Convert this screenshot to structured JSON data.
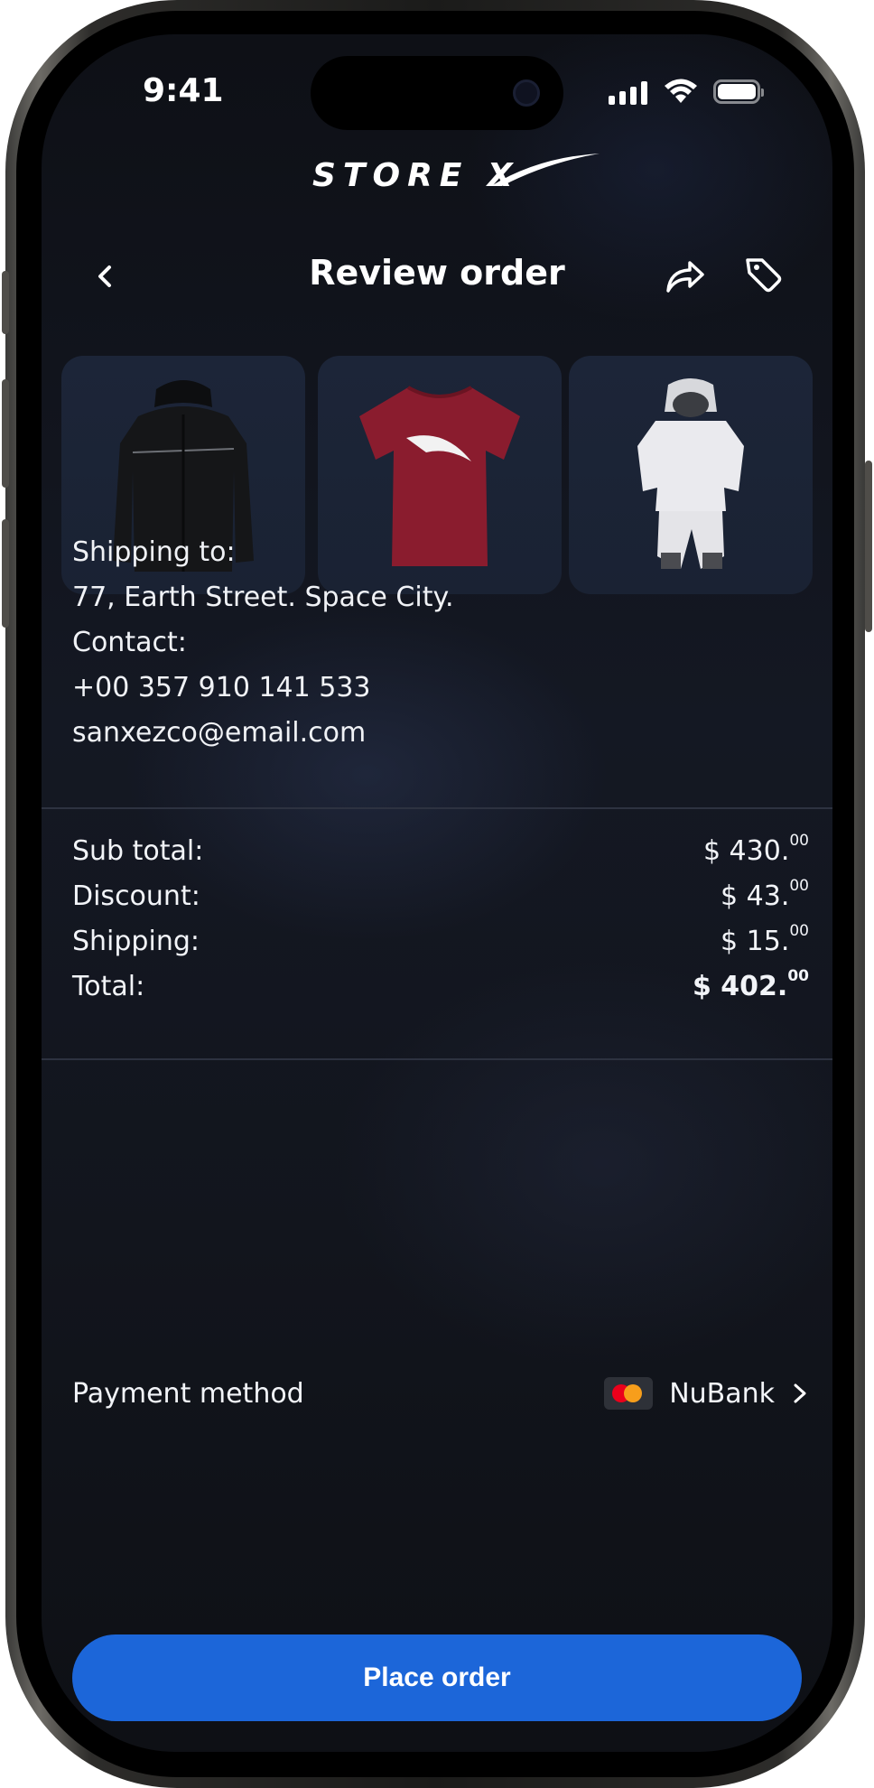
{
  "status_bar": {
    "time": "9:41"
  },
  "brand": {
    "logo_text": "STORE X"
  },
  "header": {
    "title": "Review order",
    "back_icon": "chevron-left-icon",
    "share_icon": "share-icon",
    "tag_icon": "tag-icon"
  },
  "products": [
    {
      "name": "black-jacket",
      "color": "#111214"
    },
    {
      "name": "red-tshirt",
      "color": "#8a1c2e"
    },
    {
      "name": "white-baby-spacesuit",
      "color": "#e9e9ec"
    }
  ],
  "shipping": {
    "shipping_label": "Shipping to:",
    "address": "77, Earth Street. Space City.",
    "contact_label": "Contact:",
    "phone": "+00 357 910 141 533",
    "email": "sanxezco@email.com"
  },
  "summary": {
    "subtotal": {
      "label": "Sub total:",
      "amount": "$ 430.",
      "cents": "00"
    },
    "discount": {
      "label": "Discount:",
      "amount": "$ 43.",
      "cents": "00"
    },
    "shipping": {
      "label": "Shipping:",
      "amount": "$ 15.",
      "cents": "00"
    },
    "total": {
      "label": "Total:",
      "amount": "$ 402.",
      "cents": "00"
    }
  },
  "payment": {
    "label": "Payment method",
    "card_name": "NuBank",
    "card_icon": "mastercard-icon",
    "chevron_icon": "chevron-right-icon"
  },
  "actions": {
    "place_order": "Place order"
  },
  "colors": {
    "accent": "#1c66d9",
    "background": "#12151d"
  }
}
